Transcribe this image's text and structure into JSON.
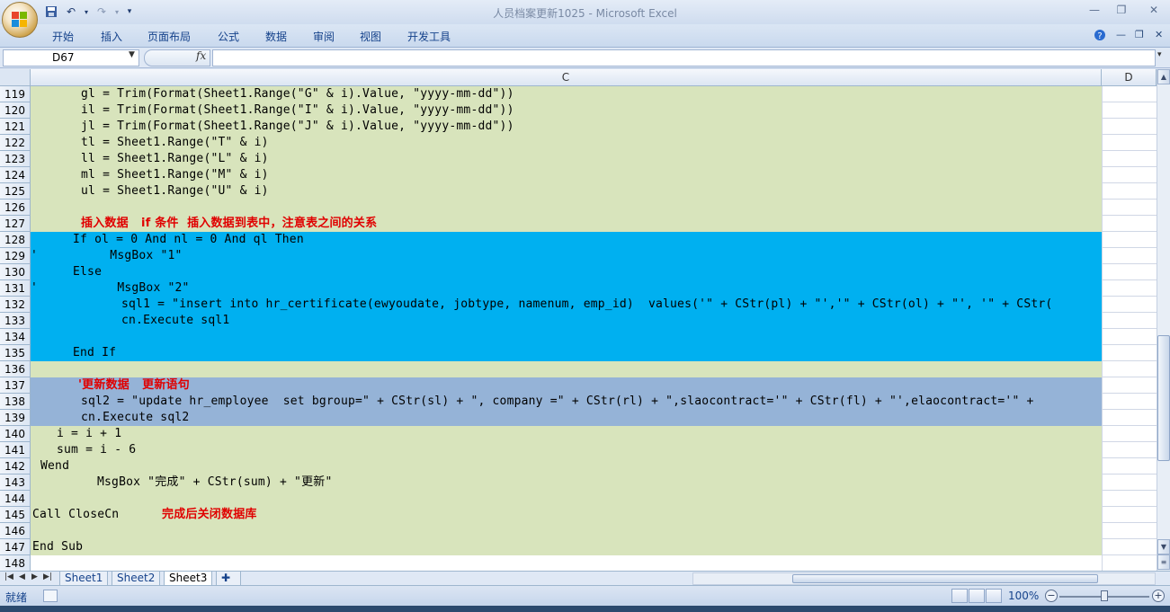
{
  "window": {
    "title": "人员档案更新1025 - Microsoft Excel"
  },
  "ribbon": {
    "tabs": [
      "开始",
      "插入",
      "页面布局",
      "公式",
      "数据",
      "审阅",
      "视图",
      "开发工具"
    ]
  },
  "formula_bar": {
    "name_box": "D67",
    "fx_label": "fx",
    "formula": ""
  },
  "grid": {
    "columns": {
      "c": "C",
      "d": "D"
    },
    "rows": [
      {
        "num": "119",
        "bg": "#d8e4bc",
        "indent": 56,
        "text": "gl = Trim(Format(Sheet1.Range(\"G\" & i).Value, \"yyyy-mm-dd\"))"
      },
      {
        "num": "120",
        "bg": "#d8e4bc",
        "indent": 56,
        "text": "il = Trim(Format(Sheet1.Range(\"I\" & i).Value, \"yyyy-mm-dd\"))"
      },
      {
        "num": "121",
        "bg": "#d8e4bc",
        "indent": 56,
        "text": "jl = Trim(Format(Sheet1.Range(\"J\" & i).Value, \"yyyy-mm-dd\"))"
      },
      {
        "num": "122",
        "bg": "#d8e4bc",
        "indent": 56,
        "text": "tl = Sheet1.Range(\"T\" & i)"
      },
      {
        "num": "123",
        "bg": "#d8e4bc",
        "indent": 56,
        "text": "ll = Sheet1.Range(\"L\" & i)"
      },
      {
        "num": "124",
        "bg": "#d8e4bc",
        "indent": 56,
        "text": "ml = Sheet1.Range(\"M\" & i)"
      },
      {
        "num": "125",
        "bg": "#d8e4bc",
        "indent": 56,
        "text": "ul = Sheet1.Range(\"U\" & i)"
      },
      {
        "num": "126",
        "bg": "#d8e4bc",
        "indent": 0,
        "text": ""
      },
      {
        "num": "127",
        "bg": "#d8e4bc",
        "indent": 56,
        "text": "插入数据   if 条件  插入数据到表中，注意表之间的关系",
        "cn": true
      },
      {
        "num": "128",
        "bg": "#00b0f0",
        "indent": 47,
        "text": "If ol = 0 And nl = 0 And ql Then"
      },
      {
        "num": "129",
        "bg": "#00b0f0",
        "indent": 0,
        "text": "'          MsgBox \"1\""
      },
      {
        "num": "130",
        "bg": "#00b0f0",
        "indent": 47,
        "text": "Else"
      },
      {
        "num": "131",
        "bg": "#00b0f0",
        "indent": 0,
        "text": "'           MsgBox \"2\""
      },
      {
        "num": "132",
        "bg": "#00b0f0",
        "indent": 101,
        "text": "sql1 = \"insert into hr_certificate(ewyoudate, jobtype, namenum, emp_id)  values('\" + CStr(pl) + \"','\" + CStr(ol) + \"', '\" + CStr("
      },
      {
        "num": "133",
        "bg": "#00b0f0",
        "indent": 101,
        "text": "cn.Execute sql1"
      },
      {
        "num": "134",
        "bg": "#00b0f0",
        "indent": 0,
        "text": ""
      },
      {
        "num": "135",
        "bg": "#00b0f0",
        "indent": 47,
        "text": "End If"
      },
      {
        "num": "136",
        "bg": "#d8e4bc",
        "indent": 0,
        "text": ""
      },
      {
        "num": "137",
        "bg": "#95b3d7",
        "indent": 53,
        "text": "'更新数据   更新语句",
        "cn": true
      },
      {
        "num": "138",
        "bg": "#95b3d7",
        "indent": 56,
        "text": "sql2 = \"update hr_employee  set bgroup=\" + CStr(sl) + \", company =\" + CStr(rl) + \",slaocontract='\" + CStr(fl) + \"',elaocontract='\" +"
      },
      {
        "num": "139",
        "bg": "#95b3d7",
        "indent": 56,
        "text": "cn.Execute sql2"
      },
      {
        "num": "140",
        "bg": "#d8e4bc",
        "indent": 29,
        "text": "i = i + 1"
      },
      {
        "num": "141",
        "bg": "#d8e4bc",
        "indent": 29,
        "text": "sum = i - 6"
      },
      {
        "num": "142",
        "bg": "#d8e4bc",
        "indent": 11,
        "text": "Wend"
      },
      {
        "num": "143",
        "bg": "#d8e4bc",
        "indent": 74,
        "text": "MsgBox \"完成\" + CStr(sum) + \"更新\""
      },
      {
        "num": "144",
        "bg": "#d8e4bc",
        "indent": 0,
        "text": ""
      },
      {
        "num": "145",
        "bg": "#d8e4bc",
        "indent": 2,
        "text": "Call CloseCn",
        "extra": "完成后关闭数据库"
      },
      {
        "num": "146",
        "bg": "#d8e4bc",
        "indent": 0,
        "text": ""
      },
      {
        "num": "147",
        "bg": "#d8e4bc",
        "indent": 2,
        "text": "End Sub"
      },
      {
        "num": "148",
        "bg": "#ffffff",
        "indent": 0,
        "text": ""
      }
    ]
  },
  "sheets": {
    "tabs": [
      "Sheet1",
      "Sheet2",
      "Sheet3"
    ],
    "active": "Sheet3"
  },
  "status": {
    "text": "就绪",
    "zoom": "100%"
  }
}
